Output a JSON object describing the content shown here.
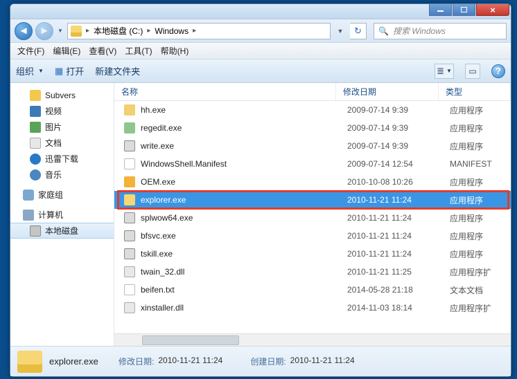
{
  "window": {
    "min": "–",
    "max": "□",
    "close": "×"
  },
  "nav": {
    "back": "◄",
    "forward": "►",
    "refresh": "↻"
  },
  "breadcrumb": {
    "seg1": "▸",
    "seg2": "本地磁盘 (C:)",
    "seg3": "▸",
    "seg4": "Windows",
    "seg5": "▸"
  },
  "search": {
    "placeholder": "搜索 Windows"
  },
  "menu": {
    "file": "文件(F)",
    "edit": "编辑(E)",
    "view": "查看(V)",
    "tools": "工具(T)",
    "help": "帮助(H)"
  },
  "toolbar": {
    "organize": "组织",
    "open": "打开",
    "newfolder": "新建文件夹",
    "view_glyph": "≣",
    "detail_glyph": "▭",
    "help_glyph": "?"
  },
  "tree": {
    "subvers": "Subvers",
    "video": "视频",
    "pic": "图片",
    "doc": "文档",
    "xunlei": "迅雷下载",
    "music": "音乐",
    "homegroup": "家庭组",
    "computer": "计算机",
    "localdisk": "本地磁盘"
  },
  "columns": {
    "name": "名称",
    "date": "修改日期",
    "type": "类型"
  },
  "files": [
    {
      "ic": "fi-hh",
      "name": "hh.exe",
      "date": "2009-07-14 9:39",
      "type": "应用程序"
    },
    {
      "ic": "fi-reg",
      "name": "regedit.exe",
      "date": "2009-07-14 9:39",
      "type": "应用程序"
    },
    {
      "ic": "fi-write",
      "name": "write.exe",
      "date": "2009-07-14 9:39",
      "type": "应用程序"
    },
    {
      "ic": "fi-man",
      "name": "WindowsShell.Manifest",
      "date": "2009-07-14 12:54",
      "type": "MANIFEST"
    },
    {
      "ic": "fi-oem",
      "name": "OEM.exe",
      "date": "2010-10-08 10:26",
      "type": "应用程序"
    },
    {
      "ic": "fi-exp",
      "name": "explorer.exe",
      "date": "2010-11-21 11:24",
      "type": "应用程序",
      "selected": true
    },
    {
      "ic": "fi-exe",
      "name": "splwow64.exe",
      "date": "2010-11-21 11:24",
      "type": "应用程序"
    },
    {
      "ic": "fi-exe",
      "name": "bfsvc.exe",
      "date": "2010-11-21 11:24",
      "type": "应用程序"
    },
    {
      "ic": "fi-exe",
      "name": "tskill.exe",
      "date": "2010-11-21 11:24",
      "type": "应用程序"
    },
    {
      "ic": "fi-dll",
      "name": "twain_32.dll",
      "date": "2010-11-21 11:25",
      "type": "应用程序扩"
    },
    {
      "ic": "fi-txt",
      "name": "beifen.txt",
      "date": "2014-05-28 21:18",
      "type": "文本文档"
    },
    {
      "ic": "fi-dll",
      "name": "xinstaller.dll",
      "date": "2014-11-03 18:14",
      "type": "应用程序扩"
    }
  ],
  "details": {
    "filename": "explorer.exe",
    "mod_k": "修改日期:",
    "mod_v": "2010-11-21 11:24",
    "create_k": "创建日期:",
    "create_v": "2010-11-21 11:24"
  }
}
